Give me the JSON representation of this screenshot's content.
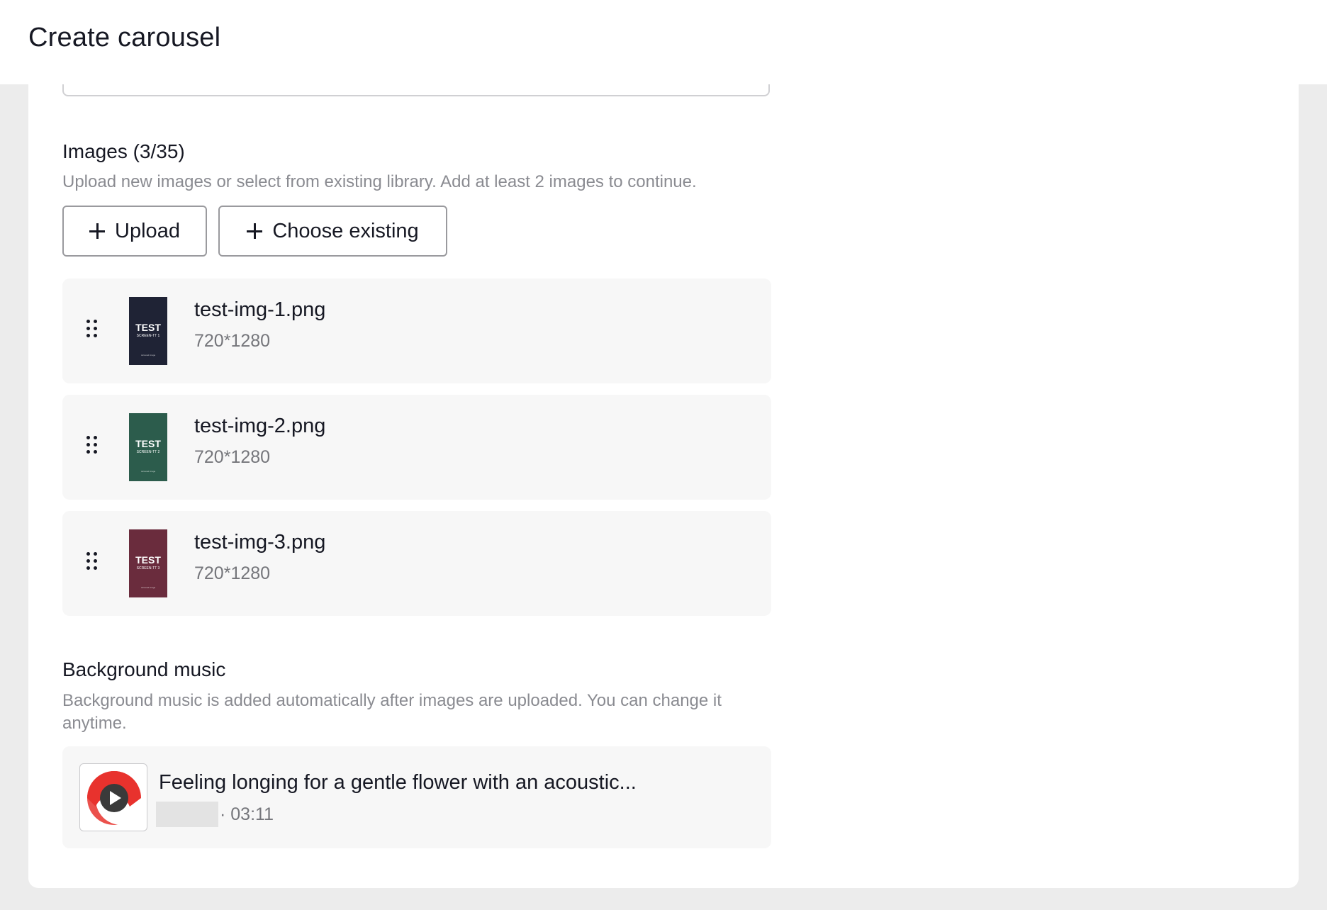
{
  "header": {
    "title": "Create carousel"
  },
  "images_section": {
    "title": "Images (3/35)",
    "description": "Upload new images or select from existing library. Add at least 2 images to continue.",
    "upload_label": "Upload",
    "choose_existing_label": "Choose existing",
    "items": [
      {
        "file_name": "test-img-1.png",
        "dimensions": "720*1280",
        "thumb_title": "TEST",
        "thumb_subtitle": "SCREEN-TT 1",
        "thumb_footer": "carousel image",
        "thumb_color": "#1f2335"
      },
      {
        "file_name": "test-img-2.png",
        "dimensions": "720*1280",
        "thumb_title": "TEST",
        "thumb_subtitle": "SCREEN-TT 2",
        "thumb_footer": "carousel image",
        "thumb_color": "#2c5c4c"
      },
      {
        "file_name": "test-img-3.png",
        "dimensions": "720*1280",
        "thumb_title": "TEST",
        "thumb_subtitle": "SCREEN-TT 3",
        "thumb_footer": "carousel image",
        "thumb_color": "#6a2c3d"
      }
    ]
  },
  "music_section": {
    "title": "Background music",
    "description": "Background music is added automatically after images are uploaded. You can change it anytime.",
    "track": {
      "title": "Feeling longing for a gentle flower with an acoustic...",
      "duration": "· 03:11"
    }
  },
  "colors": {
    "page_background": "#ececec",
    "panel_background": "#ffffff",
    "row_background": "#f7f7f7",
    "text_primary": "#161823",
    "text_secondary": "#8a8b91",
    "music_cover_red": "#e8322d"
  },
  "icons": {
    "plus": "plus-icon",
    "drag": "drag-handle-icon",
    "play": "play-icon"
  }
}
